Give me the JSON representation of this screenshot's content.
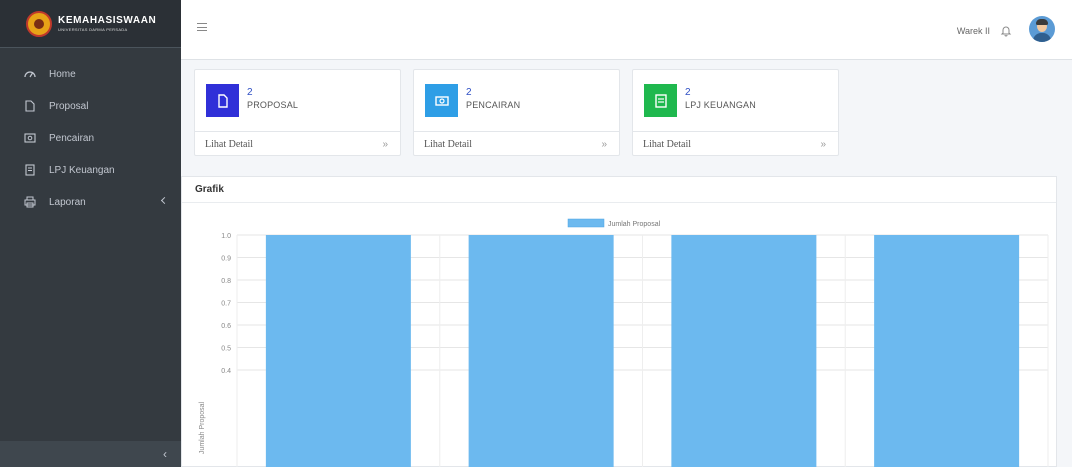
{
  "sidebar": {
    "brand_title": "KEMAHASISWAAN",
    "brand_subtitle": "UNIVERSITAS DARMA PERSADA",
    "items": [
      {
        "label": "Home",
        "icon": "dashboard-icon"
      },
      {
        "label": "Proposal",
        "icon": "file-icon"
      },
      {
        "label": "Pencairan",
        "icon": "money-icon"
      },
      {
        "label": "LPJ Keuangan",
        "icon": "book-icon"
      },
      {
        "label": "Laporan",
        "icon": "print-icon"
      }
    ],
    "collapse_label": "‹"
  },
  "topbar": {
    "user_name": "Warek II",
    "bell_icon": "bell-icon",
    "avatar_icon": "user-avatar-icon"
  },
  "info_boxes": [
    {
      "count": "2",
      "label": "PROPOSAL",
      "link": "Lihat Detail",
      "color": "#3030d8",
      "icon": "file-icon"
    },
    {
      "count": "2",
      "label": "PENCAIRAN",
      "link": "Lihat Detail",
      "color": "#2e9ee6",
      "icon": "money-icon"
    },
    {
      "count": "2",
      "label": "LPJ KEUANGAN",
      "link": "Lihat Detail",
      "color": "#1fb84e",
      "icon": "book-icon"
    }
  ],
  "card": {
    "title": "Grafik"
  },
  "chart_data": {
    "type": "bar",
    "series": [
      {
        "name": "Jumlah Proposal",
        "values": [
          1,
          1,
          1,
          1
        ]
      }
    ],
    "categories": [
      "",
      "",
      "",
      ""
    ],
    "ylabel": "Jumlah Proposal",
    "yticks": [
      "1.0",
      "0.9",
      "0.8",
      "0.7",
      "0.6",
      "0.5",
      "0.4"
    ],
    "ylim": [
      0,
      1
    ],
    "grid": true,
    "legend": "top-center",
    "bar_color": "#6cb9ef"
  }
}
